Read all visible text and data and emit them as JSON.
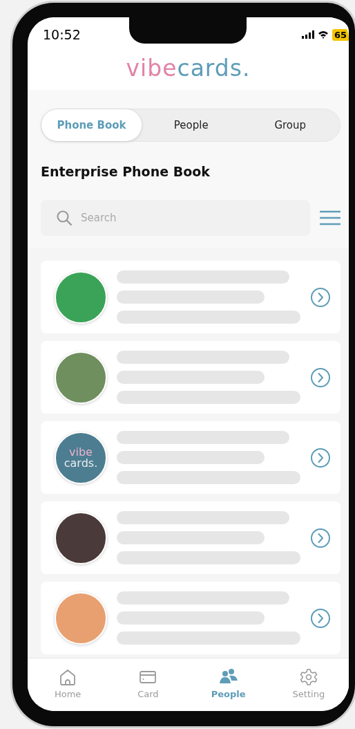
{
  "status_bar": {
    "time": "10:52",
    "battery": "65"
  },
  "logo": [
    {
      "text": "vibe",
      "color": "#e283a6"
    },
    {
      "text": "cards.",
      "color": "#5e9db8"
    }
  ],
  "tabs": [
    {
      "label": "Phone Book",
      "selected": true
    },
    {
      "label": "People",
      "selected": false
    },
    {
      "label": "Group",
      "selected": false
    }
  ],
  "heading": "Enterprise Phone Book",
  "search": {
    "placeholder": "Search"
  },
  "contacts": [
    {
      "kind": "photo",
      "color": "#3aa357"
    },
    {
      "kind": "photo",
      "color": "#6f8f5e"
    },
    {
      "kind": "logo",
      "logo_lines": [
        "vibe",
        "cards."
      ]
    },
    {
      "kind": "photo",
      "color": "#4a3a3a"
    },
    {
      "kind": "photo",
      "color": "#e8a070"
    }
  ],
  "nav": [
    {
      "kind": "home",
      "label": "Home",
      "selected": false
    },
    {
      "kind": "card",
      "label": "Card",
      "selected": false
    },
    {
      "kind": "people",
      "label": "People",
      "selected": true
    },
    {
      "kind": "setting",
      "label": "Setting",
      "selected": false
    }
  ]
}
